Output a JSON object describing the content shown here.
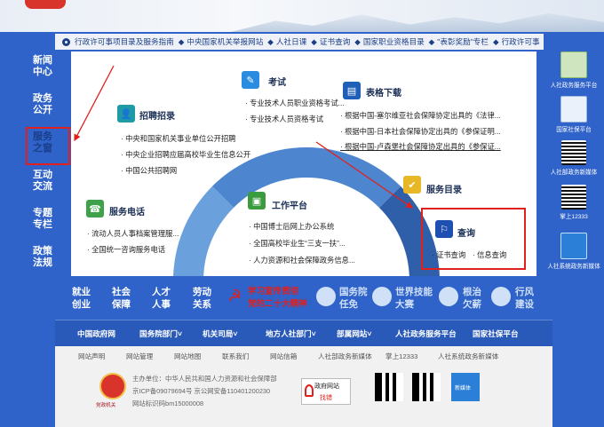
{
  "noticebar": {
    "items": [
      "行政许可事项目录及服务指南",
      "中央国家机关举报网站",
      "人社日课",
      "证书查询",
      "国家职业资格目录",
      "\"表彰奖励\"专栏",
      "行政许可事"
    ]
  },
  "leftnav": [
    {
      "label": "新闻\n中心"
    },
    {
      "label": "政务\n公开"
    },
    {
      "label": "服务\n之窗"
    },
    {
      "label": "互动\n交流"
    },
    {
      "label": "专题\n专栏"
    },
    {
      "label": "政策\n法规"
    }
  ],
  "blocks": {
    "recruit": {
      "title": "招聘招录",
      "lines": [
        "中央和国家机关事业单位公开招聘",
        "中央企业招聘应届高校毕业生信息公开",
        "中国公共招聘网"
      ]
    },
    "exam": {
      "title": "考试",
      "lines": [
        "专业技术人员职业资格考试...",
        "专业技术人员资格考试"
      ]
    },
    "forms": {
      "title": "表格下载",
      "lines": [
        "根据中国-塞尔维亚社会保障协定出具的《法律...",
        "根据中国-日本社会保障协定出具的《参保证明...",
        "根据中国-卢森堡社会保障协定出具的《参保证..."
      ]
    },
    "phone": {
      "title": "服务电话",
      "lines": [
        "流动人员人事档案管理服...",
        "全国统一咨询服务电话"
      ]
    },
    "work": {
      "title": "工作平台",
      "lines": [
        "中国博士后网上办公系统",
        "全国高校毕业生“三支一扶”...",
        "人力资源和社会保障政务信息..."
      ]
    },
    "catalog": {
      "title": "服务目录"
    },
    "query": {
      "title": "查询",
      "lines": [
        "证书查询",
        "信息查询"
      ]
    }
  },
  "rightcol": [
    {
      "label": "人社政务服务平台"
    },
    {
      "label": "国家社保平台"
    },
    {
      "label": "人社部政务新媒体"
    },
    {
      "label": "掌上12333"
    },
    {
      "label": "人社系统政务新媒体"
    }
  ],
  "services": {
    "col1": "就业\n创业",
    "col2": "社会\n保障",
    "col3": "人才\n人事",
    "col4": "劳动\n关系",
    "banner": "学习宣传贯彻\n党的二十大精神",
    "guowuyuan": "国务院\n任免",
    "skills": "世界技能\n大赛",
    "wages": "根治\n欠薪",
    "style": "行风\n建设"
  },
  "links": [
    "中国政府网",
    "国务院部门˅",
    "机关司局˅",
    "地方人社部门˅",
    "部属网站˅",
    "人社政务服务平台",
    "国家社保平台"
  ],
  "footer": {
    "links": [
      "网站声明",
      "网站管理",
      "网站地图",
      "联系我们",
      "网站信箱",
      "人社部政务新媒体",
      "掌上12333",
      "人社系统政务新媒体"
    ],
    "host": "主办单位：中华人民共和国人力资源和社会保障部",
    "icp": "京ICP备09079694号 京公网安备110401200230",
    "code": "网站标识码bm15000008",
    "emblem_text": "党政机关",
    "jiucuo_top": "政府网站",
    "jiucuo_bottom": "找错",
    "badge": "新媒体"
  },
  "colors": {
    "bg": "#2f63c9",
    "accent_red": "#e0201d",
    "title": "#1a2e55"
  }
}
